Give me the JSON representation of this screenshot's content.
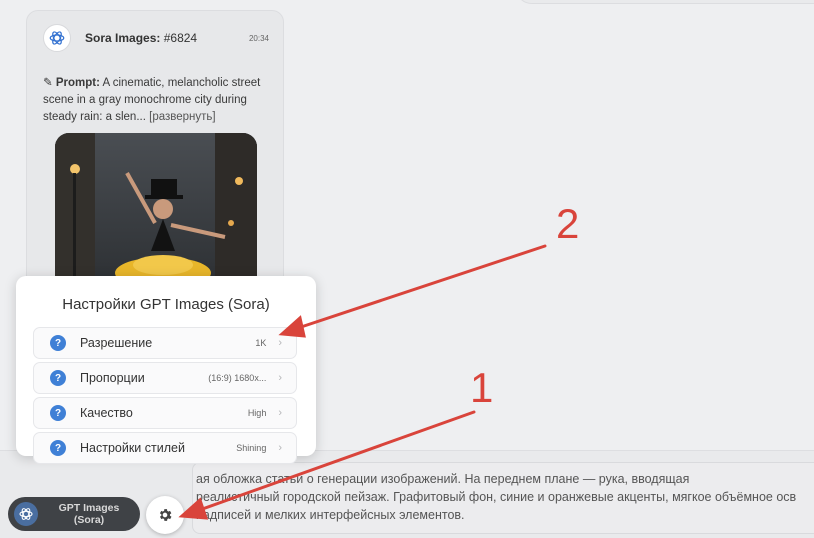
{
  "message": {
    "title": "Sora Images:",
    "number": "#6824",
    "time": "20:34",
    "prompt_label": "Prompt",
    "prompt_text": "A cinematic, melancholic street scene in a gray monochrome city during steady rain: a slen...",
    "expand_label": "[развернуть]"
  },
  "popup": {
    "title": "Настройки GPT Images (Sora)",
    "rows": [
      {
        "label": "Разрешение",
        "value": "1K"
      },
      {
        "label": "Пропорции",
        "value": "(16:9) 1680x..."
      },
      {
        "label": "Качество",
        "value": "High"
      },
      {
        "label": "Настройки стилей",
        "value": "Shining"
      }
    ]
  },
  "input": {
    "line1": "ая обложка статьи о генерации изображений. На переднем плане — рука, вводящая",
    "line2": "реалистичный городской пейзаж. Графитовый фон, синие и оранжевые акценты, мягкое объёмное осв",
    "line3": "надписей и мелких интерфейсных элементов."
  },
  "model_selector": {
    "line1": "GPT Images",
    "line2": "(Sora)"
  },
  "annotations": {
    "one": "1",
    "two": "2",
    "color": "#d9443b"
  }
}
